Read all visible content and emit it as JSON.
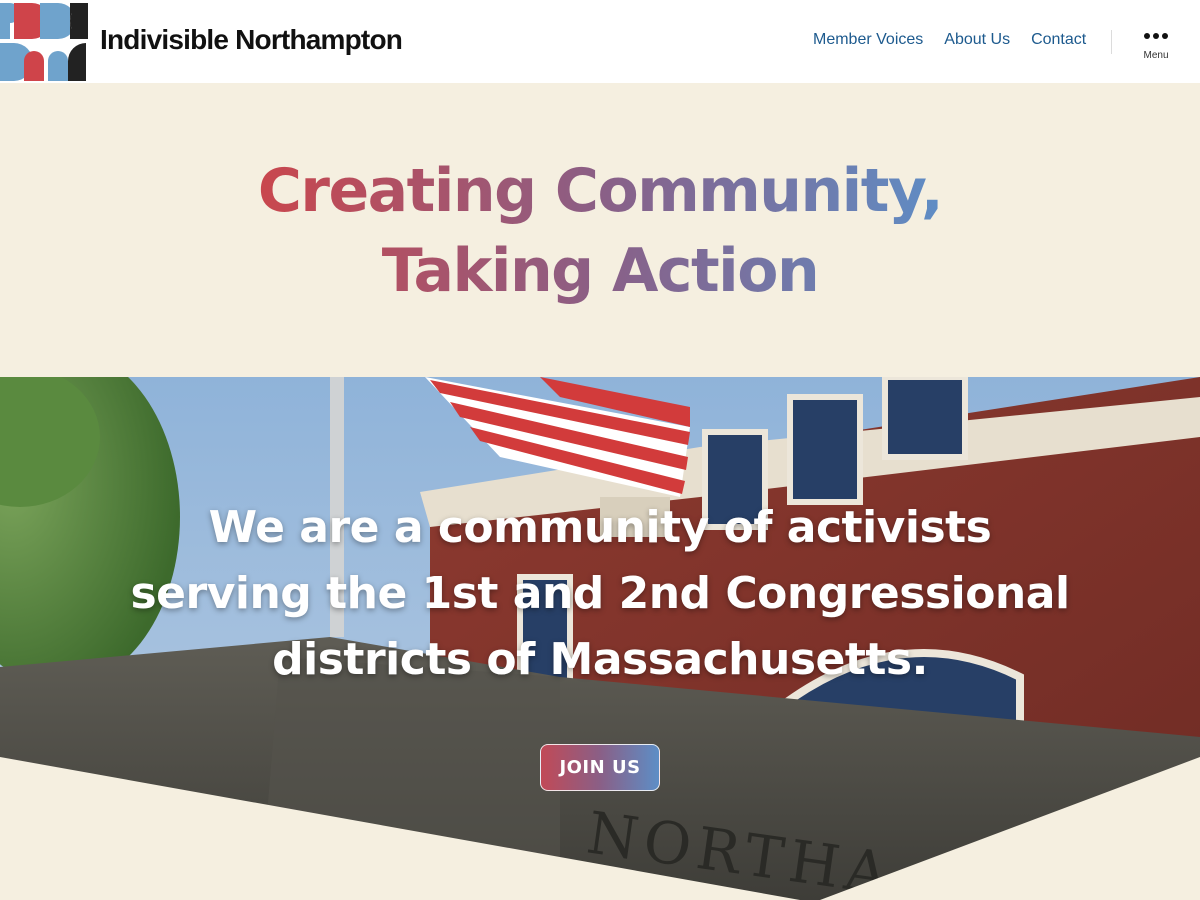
{
  "site": {
    "title": "Indivisible Northampton"
  },
  "nav": {
    "items": [
      {
        "label": "Member Voices"
      },
      {
        "label": "About Us"
      },
      {
        "label": "Contact"
      }
    ],
    "menu_label": "Menu"
  },
  "hero": {
    "title_line1": "Creating Community,",
    "title_line2": "Taking Action"
  },
  "photo_section": {
    "line1": "We are a community of activists",
    "line2": "serving the 1st and 2nd Congressional",
    "line3": "districts of Massachusetts.",
    "cta_label": "JOIN US",
    "engraved_text": "NORTHA"
  },
  "colors": {
    "cream": "#f5efe0",
    "red": "#c8474e",
    "blue": "#5f8cc4",
    "nav_blue": "#1d5a8e"
  }
}
